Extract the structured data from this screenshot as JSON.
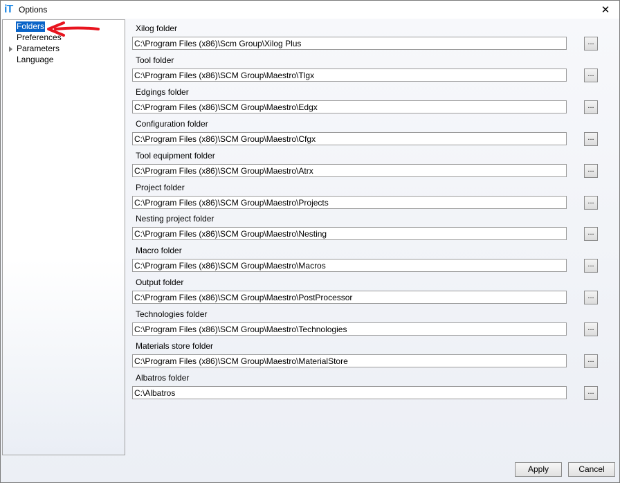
{
  "window": {
    "title": "Options",
    "app_icon_text": "iT",
    "close_glyph": "✕"
  },
  "sidebar": {
    "items": [
      {
        "label": "Folders",
        "selected": true
      },
      {
        "label": "Preferences"
      },
      {
        "label": "Parameters",
        "expandable": true
      },
      {
        "label": "Language"
      }
    ]
  },
  "folders": [
    {
      "label": "Xilog folder",
      "value": "C:\\Program Files (x86)\\Scm Group\\Xilog Plus"
    },
    {
      "label": "Tool folder",
      "value": "C:\\Program Files (x86)\\SCM Group\\Maestro\\Tlgx"
    },
    {
      "label": "Edgings folder",
      "value": "C:\\Program Files (x86)\\SCM Group\\Maestro\\Edgx"
    },
    {
      "label": "Configuration folder",
      "value": "C:\\Program Files (x86)\\SCM Group\\Maestro\\Cfgx"
    },
    {
      "label": "Tool equipment folder",
      "value": "C:\\Program Files (x86)\\SCM Group\\Maestro\\Atrx"
    },
    {
      "label": "Project folder",
      "value": "C:\\Program Files (x86)\\SCM Group\\Maestro\\Projects"
    },
    {
      "label": "Nesting project folder",
      "value": "C:\\Program Files (x86)\\SCM Group\\Maestro\\Nesting"
    },
    {
      "label": "Macro folder",
      "value": "C:\\Program Files (x86)\\SCM Group\\Maestro\\Macros"
    },
    {
      "label": "Output folder",
      "value": "C:\\Program Files (x86)\\SCM Group\\Maestro\\PostProcessor"
    },
    {
      "label": "Technologies folder",
      "value": "C:\\Program Files (x86)\\SCM Group\\Maestro\\Technologies"
    },
    {
      "label": "Materials store folder",
      "value": "C:\\Program Files (x86)\\SCM Group\\Maestro\\MaterialStore"
    },
    {
      "label": "Albatros folder",
      "value": "C:\\Albatros"
    }
  ],
  "browse_label": "...",
  "buttons": {
    "apply": "Apply",
    "cancel": "Cancel"
  },
  "colors": {
    "selection": "#0a64c8",
    "annotation_arrow": "#e8141e",
    "app_icon": "#1e88e5"
  }
}
